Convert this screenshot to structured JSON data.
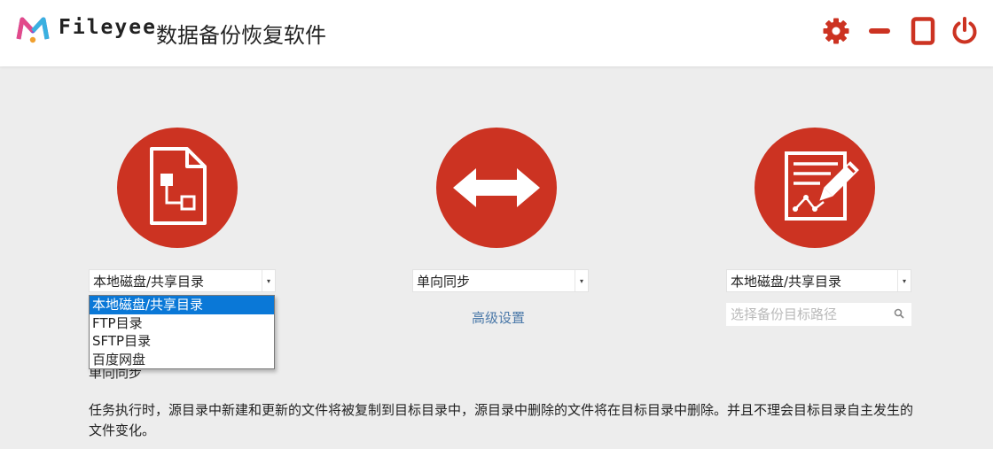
{
  "header": {
    "brand": "Fileyee",
    "title": "数据备份恢复软件",
    "icons": [
      "settings-gear-icon",
      "minimize-icon",
      "maximize-icon",
      "power-icon"
    ],
    "accent_color": "#cc3322"
  },
  "source": {
    "icon": "file-flowchart-icon",
    "select_value": "本地磁盘/共享目录",
    "options": [
      "本地磁盘/共享目录",
      "FTP目录",
      "SFTP目录",
      "百度网盘"
    ],
    "selected_option": "本地磁盘/共享目录"
  },
  "sync": {
    "icon": "double-arrow-icon",
    "select_value": "单向同步",
    "advanced_link": "高级设置"
  },
  "target": {
    "icon": "edit-document-icon",
    "select_value": "本地磁盘/共享目录",
    "path_placeholder": "选择备份目标路径"
  },
  "description": {
    "mode_title": "单向同步",
    "text": "任务执行时，源目录中新建和更新的文件将被复制到目标目录中，源目录中删除的文件将在目标目录中删除。并且不理会目标目录自主发生的文件变化。"
  }
}
